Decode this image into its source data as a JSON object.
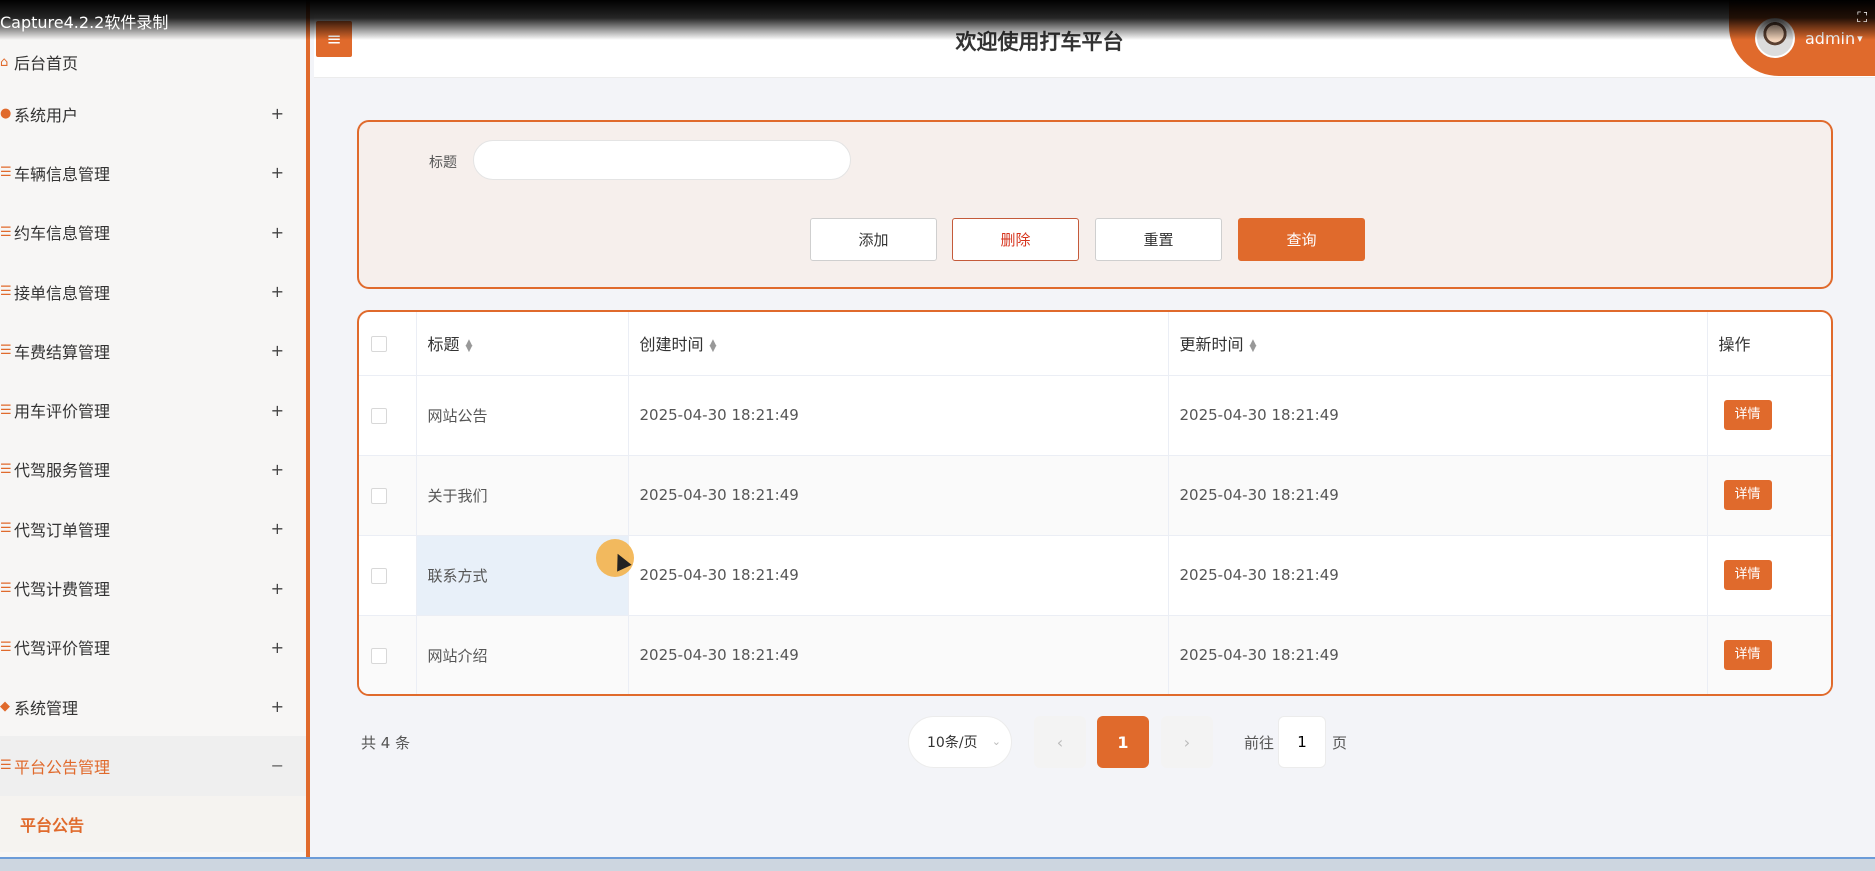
{
  "recorder": {
    "label": "Capture4.2.2软件录制"
  },
  "header": {
    "title": "欢迎使用打车平台",
    "menu_icon": "≡",
    "user": "admin"
  },
  "sidebar": {
    "items": [
      {
        "label": "后台首页",
        "icon": "home-icon",
        "glyph": "⌂",
        "expand": ""
      },
      {
        "label": "系统用户",
        "icon": "user-icon",
        "glyph": "●",
        "expand": "+"
      },
      {
        "label": "车辆信息管理",
        "icon": "list-icon",
        "glyph": "☰",
        "expand": "+"
      },
      {
        "label": "约车信息管理",
        "icon": "list-icon",
        "glyph": "☰",
        "expand": "+"
      },
      {
        "label": "接单信息管理",
        "icon": "list-icon",
        "glyph": "☰",
        "expand": "+"
      },
      {
        "label": "车费结算管理",
        "icon": "list-icon",
        "glyph": "☰",
        "expand": "+"
      },
      {
        "label": "用车评价管理",
        "icon": "list-icon",
        "glyph": "☰",
        "expand": "+"
      },
      {
        "label": "代驾服务管理",
        "icon": "list-icon",
        "glyph": "☰",
        "expand": "+"
      },
      {
        "label": "代驾订单管理",
        "icon": "list-icon",
        "glyph": "☰",
        "expand": "+"
      },
      {
        "label": "代驾计费管理",
        "icon": "list-icon",
        "glyph": "☰",
        "expand": "+"
      },
      {
        "label": "代驾评价管理",
        "icon": "list-icon",
        "glyph": "☰",
        "expand": "+"
      },
      {
        "label": "系统管理",
        "icon": "gear-icon",
        "glyph": "◆",
        "expand": "+"
      },
      {
        "label": "平台公告管理",
        "icon": "list-icon",
        "glyph": "☰",
        "expand": "−"
      }
    ],
    "sub_item": "平台公告"
  },
  "search": {
    "label": "标题",
    "value": "",
    "placeholder": ""
  },
  "buttons": {
    "add": "添加",
    "delete": "删除",
    "reset": "重置",
    "query": "查询"
  },
  "table": {
    "columns": [
      "标题",
      "创建时间",
      "更新时间",
      "操作"
    ],
    "rows": [
      {
        "title": "网站公告",
        "created": "2025-04-30 18:21:49",
        "updated": "2025-04-30 18:21:49",
        "action": "详情"
      },
      {
        "title": "关于我们",
        "created": "2025-04-30 18:21:49",
        "updated": "2025-04-30 18:21:49",
        "action": "详情"
      },
      {
        "title": "联系方式",
        "created": "2025-04-30 18:21:49",
        "updated": "2025-04-30 18:21:49",
        "action": "详情"
      },
      {
        "title": "网站介绍",
        "created": "2025-04-30 18:21:49",
        "updated": "2025-04-30 18:21:49",
        "action": "详情"
      }
    ]
  },
  "pagination": {
    "total": "共 4 条",
    "page_size": "10条/页",
    "current_page": "1",
    "goto_label": "前往",
    "goto_value": "1",
    "goto_unit": "页",
    "prev": "‹",
    "next": "›"
  },
  "colors": {
    "accent": "#e06a2c",
    "danger_text": "#d6341d",
    "background": "#f3f4f8"
  }
}
